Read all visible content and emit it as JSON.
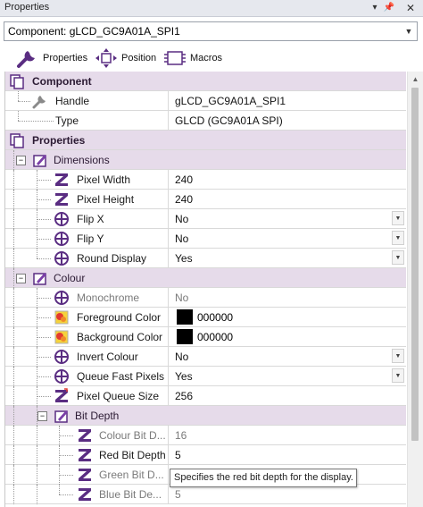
{
  "window": {
    "title": "Properties"
  },
  "component_select": {
    "value": "Component: gLCD_GC9A01A_SPI1"
  },
  "toolbar": {
    "properties_label": "Properties",
    "position_label": "Position",
    "macros_label": "Macros"
  },
  "sections": {
    "component": {
      "label": "Component",
      "handle": {
        "label": "Handle",
        "value": "gLCD_GC9A01A_SPI1"
      },
      "type": {
        "label": "Type",
        "value": "GLCD (GC9A01A SPI)"
      }
    },
    "properties": {
      "label": "Properties"
    },
    "dimensions": {
      "label": "Dimensions",
      "pixel_width": {
        "label": "Pixel Width",
        "value": "240"
      },
      "pixel_height": {
        "label": "Pixel Height",
        "value": "240"
      },
      "flip_x": {
        "label": "Flip X",
        "value": "No"
      },
      "flip_y": {
        "label": "Flip Y",
        "value": "No"
      },
      "round_display": {
        "label": "Round Display",
        "value": "Yes"
      }
    },
    "colour": {
      "label": "Colour",
      "monochrome": {
        "label": "Monochrome",
        "value": "No"
      },
      "foreground": {
        "label": "Foreground Color",
        "value": "000000",
        "swatch": "#000000"
      },
      "background": {
        "label": "Background Color",
        "value": "000000",
        "swatch": "#000000"
      },
      "invert": {
        "label": "Invert Colour",
        "value": "No"
      },
      "queue_fast": {
        "label": "Queue Fast Pixels",
        "value": "Yes"
      },
      "queue_size": {
        "label": "Pixel Queue Size",
        "value": "256"
      }
    },
    "bit_depth": {
      "label": "Bit Depth",
      "colour_bit_depth": {
        "label": "Colour Bit D...",
        "value": "16"
      },
      "red_bit_depth": {
        "label": "Red Bit Depth",
        "value": "5"
      },
      "green_bit_depth": {
        "label": "Green Bit D...",
        "value": ""
      },
      "blue_bit_depth": {
        "label": "Blue Bit De...",
        "value": "5"
      }
    }
  },
  "tooltip": {
    "text": "Specifies the red bit depth for the display."
  },
  "colors": {
    "category_bg": "#e6dbea",
    "icon_purple": "#5a2d82"
  }
}
